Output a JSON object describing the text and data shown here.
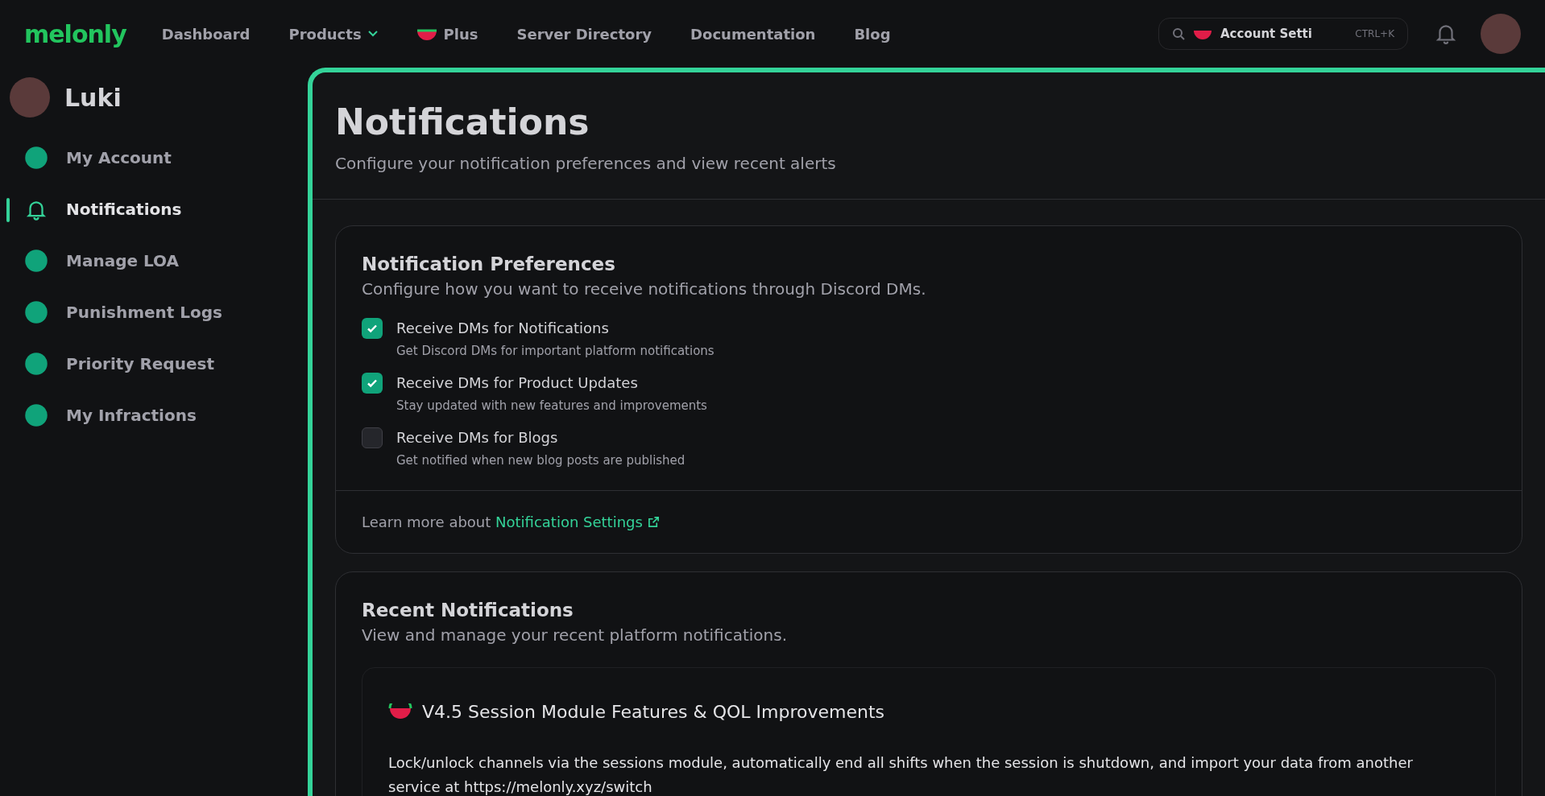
{
  "topbar": {
    "logo": "melonly",
    "nav": [
      {
        "label": "Dashboard",
        "kind": "link"
      },
      {
        "label": "Products",
        "kind": "dropdown"
      },
      {
        "label": "Plus",
        "kind": "plus"
      },
      {
        "label": "Server Directory",
        "kind": "link"
      },
      {
        "label": "Documentation",
        "kind": "link"
      },
      {
        "label": "Blog",
        "kind": "link"
      }
    ],
    "search": {
      "value": "Account Setti",
      "shortcut": "CTRL+K"
    }
  },
  "sidebar": {
    "user": "Luki",
    "items": [
      {
        "label": "My Account",
        "selected": false
      },
      {
        "label": "Notifications",
        "selected": true
      },
      {
        "label": "Manage LOA",
        "selected": false
      },
      {
        "label": "Punishment Logs",
        "selected": false
      },
      {
        "label": "Priority Request",
        "selected": false
      },
      {
        "label": "My Infractions",
        "selected": false
      }
    ]
  },
  "page": {
    "title": "Notifications",
    "subtitle": "Configure your notification preferences and view recent alerts"
  },
  "preferences": {
    "title": "Notification Preferences",
    "subtitle": "Configure how you want to receive notifications through Discord DMs.",
    "options": [
      {
        "label": "Receive DMs for Notifications",
        "description": "Get Discord DMs for important platform notifications",
        "checked": true
      },
      {
        "label": "Receive DMs for Product Updates",
        "description": "Stay updated with new features and improvements",
        "checked": true
      },
      {
        "label": "Receive DMs for Blogs",
        "description": "Get notified when new blog posts are published",
        "checked": false
      }
    ],
    "footer_text": "Learn more about",
    "footer_link": "Notification Settings"
  },
  "recent": {
    "title": "Recent Notifications",
    "subtitle": "View and manage your recent platform notifications.",
    "items": [
      {
        "title": "V4.5 Session Module Features & QOL Improvements",
        "body": "Lock/unlock channels via the sessions module, automatically end all shifts when the session is shutdown, and import your data from another service at https://melonly.xyz/switch"
      }
    ]
  }
}
